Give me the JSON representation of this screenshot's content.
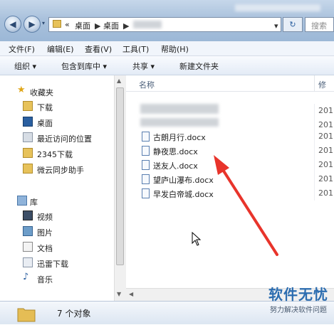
{
  "window": {
    "breadcrumb": {
      "overflow_icon": "«",
      "segments": [
        "桌面",
        "桌面"
      ]
    },
    "refresh_icon": "refresh-icon",
    "search_placeholder": "搜索"
  },
  "menubar": {
    "items": [
      "文件(F)",
      "编辑(E)",
      "查看(V)",
      "工具(T)",
      "帮助(H)"
    ]
  },
  "toolbar": {
    "items": [
      "组织 ▾",
      "包含到库中 ▾",
      "共享 ▾",
      "新建文件夹"
    ]
  },
  "sidebar": {
    "favorites_title": "收藏夹",
    "favorites": [
      "下载",
      "桌面",
      "最近访问的位置",
      "2345下载",
      "微云同步助手"
    ],
    "library_title": "库",
    "library": [
      "视频",
      "图片",
      "文档",
      "迅雷下载",
      "音乐"
    ]
  },
  "columns": {
    "name": "名称",
    "date": "修"
  },
  "files": [
    {
      "name": "古朗月行.docx",
      "date": "201"
    },
    {
      "name": "静夜思.docx",
      "date": "201"
    },
    {
      "name": "送友人.docx",
      "date": "201"
    },
    {
      "name": "望庐山瀑布.docx",
      "date": "201"
    },
    {
      "name": "早发白帝城.docx",
      "date": "201"
    }
  ],
  "hidden_rows_dates": [
    "201",
    "201"
  ],
  "status": {
    "count": "7 个对象"
  },
  "watermark": {
    "brand": "软件无忧",
    "slogan": "努力解决软件问题"
  },
  "colors": {
    "title_gradient": "#a9c1dc",
    "arrow": "#e8342b",
    "watermark": "#2c6db0"
  }
}
